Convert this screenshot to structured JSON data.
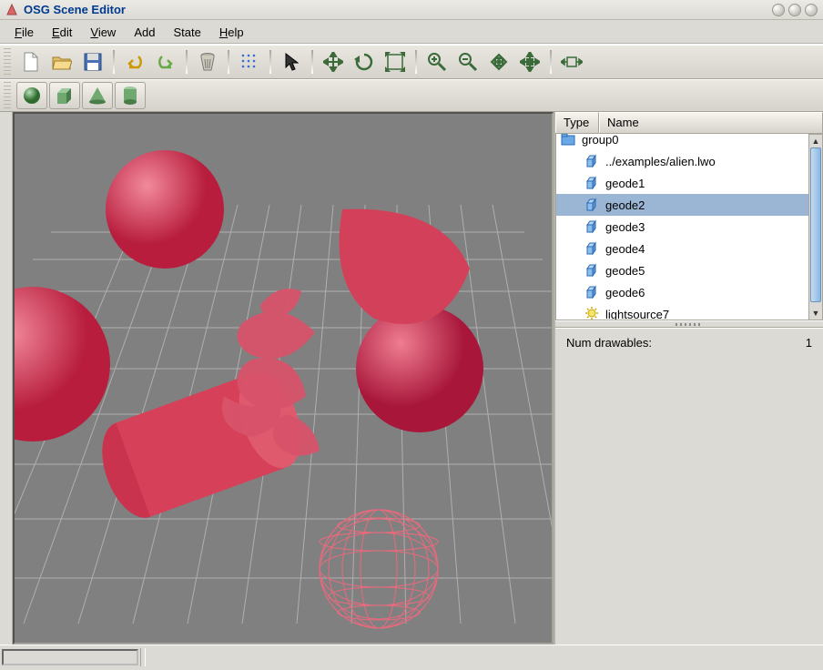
{
  "title": "OSG Scene Editor",
  "menus": [
    "File",
    "Edit",
    "View",
    "Add",
    "State",
    "Help"
  ],
  "menu_underline_idx": [
    0,
    0,
    0,
    -1,
    -1,
    0
  ],
  "toolbar_icons": [
    "new-file",
    "open-file",
    "save-file",
    "|",
    "undo",
    "redo",
    "|",
    "delete",
    "|",
    "snap-grid",
    "|",
    "select-arrow",
    "|",
    "move",
    "rotate",
    "scale-box",
    "|",
    "zoom-in",
    "zoom-out",
    "zoom-fit",
    "zoom-extents",
    "|",
    "home-view"
  ],
  "shape_icons": [
    "sphere-shape",
    "box-shape",
    "cone-shape",
    "cylinder-shape"
  ],
  "tree": {
    "columns": {
      "type": "Type",
      "name": "Name"
    },
    "rows": [
      {
        "icon": "group-icon",
        "label": "group0",
        "selected": false,
        "partial": true
      },
      {
        "icon": "box-node-icon",
        "label": "../examples/alien.lwo",
        "selected": false
      },
      {
        "icon": "box-node-icon",
        "label": "geode1",
        "selected": false
      },
      {
        "icon": "box-node-icon",
        "label": "geode2",
        "selected": true
      },
      {
        "icon": "box-node-icon",
        "label": "geode3",
        "selected": false
      },
      {
        "icon": "box-node-icon",
        "label": "geode4",
        "selected": false
      },
      {
        "icon": "box-node-icon",
        "label": "geode5",
        "selected": false
      },
      {
        "icon": "box-node-icon",
        "label": "geode6",
        "selected": false
      },
      {
        "icon": "light-icon",
        "label": "lightsource7",
        "selected": false
      }
    ]
  },
  "properties": {
    "label": "Num drawables:",
    "value": "1"
  }
}
